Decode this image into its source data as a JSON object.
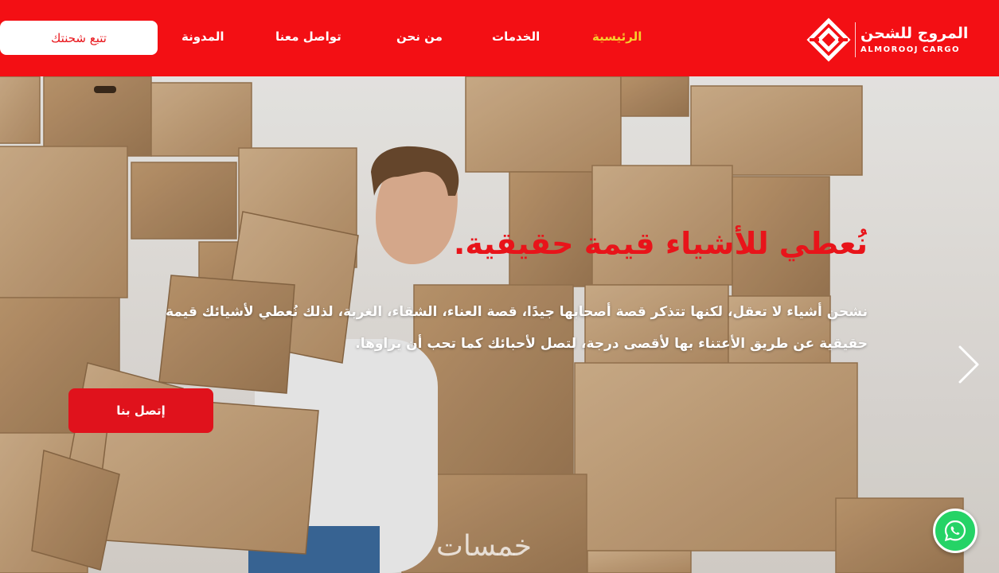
{
  "header": {
    "logo": {
      "arabic": "المروج للشحن",
      "english": "ALMOROOJ CARGO"
    },
    "nav": [
      {
        "id": "home",
        "label": "الرئيسية",
        "active": true
      },
      {
        "id": "services",
        "label": "الخدمات",
        "active": false
      },
      {
        "id": "about",
        "label": "من نحن",
        "active": false
      },
      {
        "id": "contact",
        "label": "تواصل معنا",
        "active": false
      },
      {
        "id": "blog",
        "label": "المدونة",
        "active": false
      }
    ],
    "track_button": "تتبع شحنتك"
  },
  "hero": {
    "title": "نُعطي للأشياء قيمة حقيقية.",
    "text": "نشحن أشياء لا تعقل، لكنها تتذكر قصة أصحابها جيدًا، قصة العناء، الشقاء، الغربة، لذلك نُعطي لأشيائك قيمة حقيقية عن طريق الأعتناء بها لأقصى درجة، لتصل لأحبائك كما تحب أن يراوها.",
    "cta": "إتصل بنا"
  },
  "watermark": "خمسات",
  "icons": {
    "logo": "diamond-logo-icon",
    "next": "chevron-right-icon",
    "whatsapp": "whatsapp-icon"
  },
  "colors": {
    "brand_red": "#f30f14",
    "active_nav": "#f6cf2e",
    "title_red": "#e8141a",
    "whatsapp_green": "#25d366"
  }
}
